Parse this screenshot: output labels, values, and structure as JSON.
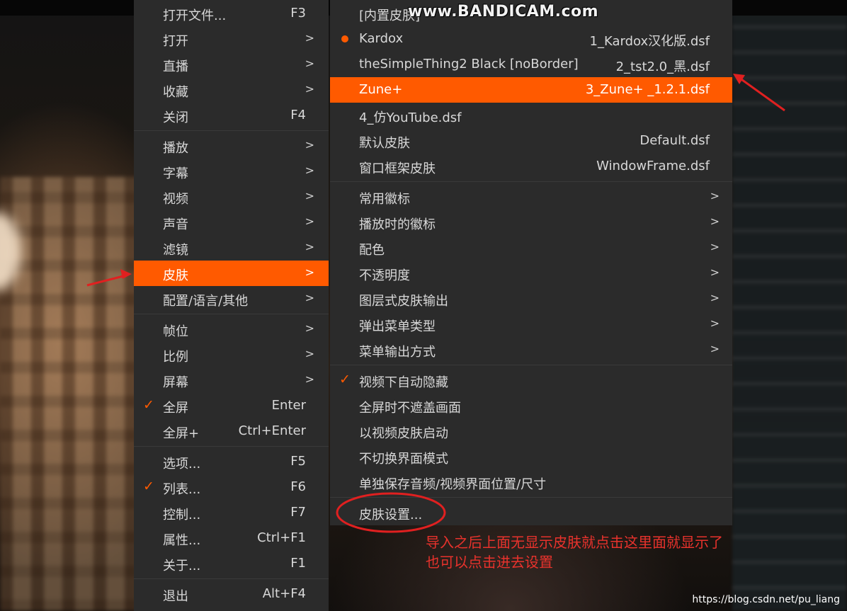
{
  "main_menu": {
    "items": [
      {
        "label": "打开文件...",
        "shortcut": "F3"
      },
      {
        "label": "打开",
        "arrow": ">"
      },
      {
        "label": "直播",
        "arrow": ">"
      },
      {
        "label": "收藏",
        "arrow": ">"
      },
      {
        "label": "关闭",
        "shortcut": "F4"
      },
      {
        "label": "播放",
        "arrow": ">"
      },
      {
        "label": "字幕",
        "arrow": ">"
      },
      {
        "label": "视频",
        "arrow": ">"
      },
      {
        "label": "声音",
        "arrow": ">"
      },
      {
        "label": "滤镜",
        "arrow": ">"
      },
      {
        "label": "皮肤",
        "arrow": ">"
      },
      {
        "label": "配置/语言/其他",
        "arrow": ">"
      },
      {
        "label": "帧位",
        "arrow": ">"
      },
      {
        "label": "比例",
        "arrow": ">"
      },
      {
        "label": "屏幕",
        "arrow": ">"
      },
      {
        "label": "全屏",
        "shortcut": "Enter"
      },
      {
        "label": "全屏+",
        "shortcut": "Ctrl+Enter"
      },
      {
        "label": "选项...",
        "shortcut": "F5"
      },
      {
        "label": "列表...",
        "shortcut": "F6"
      },
      {
        "label": "控制...",
        "shortcut": "F7"
      },
      {
        "label": "属性...",
        "shortcut": "Ctrl+F1"
      },
      {
        "label": "关于...",
        "shortcut": "F1"
      },
      {
        "label": "退出",
        "shortcut": "Alt+F4"
      }
    ]
  },
  "skin_menu": {
    "items": [
      {
        "label": "[内置皮肤]"
      },
      {
        "label": "Kardox",
        "file": "1_Kardox汉化版.dsf"
      },
      {
        "label": "theSimpleThing2 Black [noBorder]",
        "file": "2_tst2.0_黑.dsf"
      },
      {
        "label": "Zune+",
        "file": "3_Zune+ _1.2.1.dsf"
      },
      {
        "label": "4_仿YouTube.dsf"
      },
      {
        "label": "默认皮肤",
        "file": "Default.dsf"
      },
      {
        "label": "窗口框架皮肤",
        "file": "WindowFrame.dsf"
      },
      {
        "label": "常用徽标",
        "arrow": ">"
      },
      {
        "label": "播放时的徽标",
        "arrow": ">"
      },
      {
        "label": "配色",
        "arrow": ">"
      },
      {
        "label": "不透明度",
        "arrow": ">"
      },
      {
        "label": "图层式皮肤输出",
        "arrow": ">"
      },
      {
        "label": "弹出菜单类型",
        "arrow": ">"
      },
      {
        "label": "菜单输出方式",
        "arrow": ">"
      },
      {
        "label": "视频下自动隐藏"
      },
      {
        "label": "全屏时不遮盖画面"
      },
      {
        "label": "以视频皮肤启动"
      },
      {
        "label": "不切换界面模式"
      },
      {
        "label": "单独保存音频/视频界面位置/尺寸"
      },
      {
        "label": "皮肤设置..."
      }
    ]
  },
  "overlay": {
    "watermark": "www.BANDICAM.com",
    "annotation_line1": "导入之后上面无显示皮肤就点击这里面就显示了",
    "annotation_line2": "也可以点击进去设置",
    "source_url": "https://blog.csdn.net/pu_liang"
  },
  "colors": {
    "accent": "#ff5a00",
    "menu_bg": "#2b2b2b",
    "annotation": "#e8322c"
  },
  "icons": [
    "check-icon",
    "radio-dot-icon",
    "submenu-arrow-icon"
  ]
}
